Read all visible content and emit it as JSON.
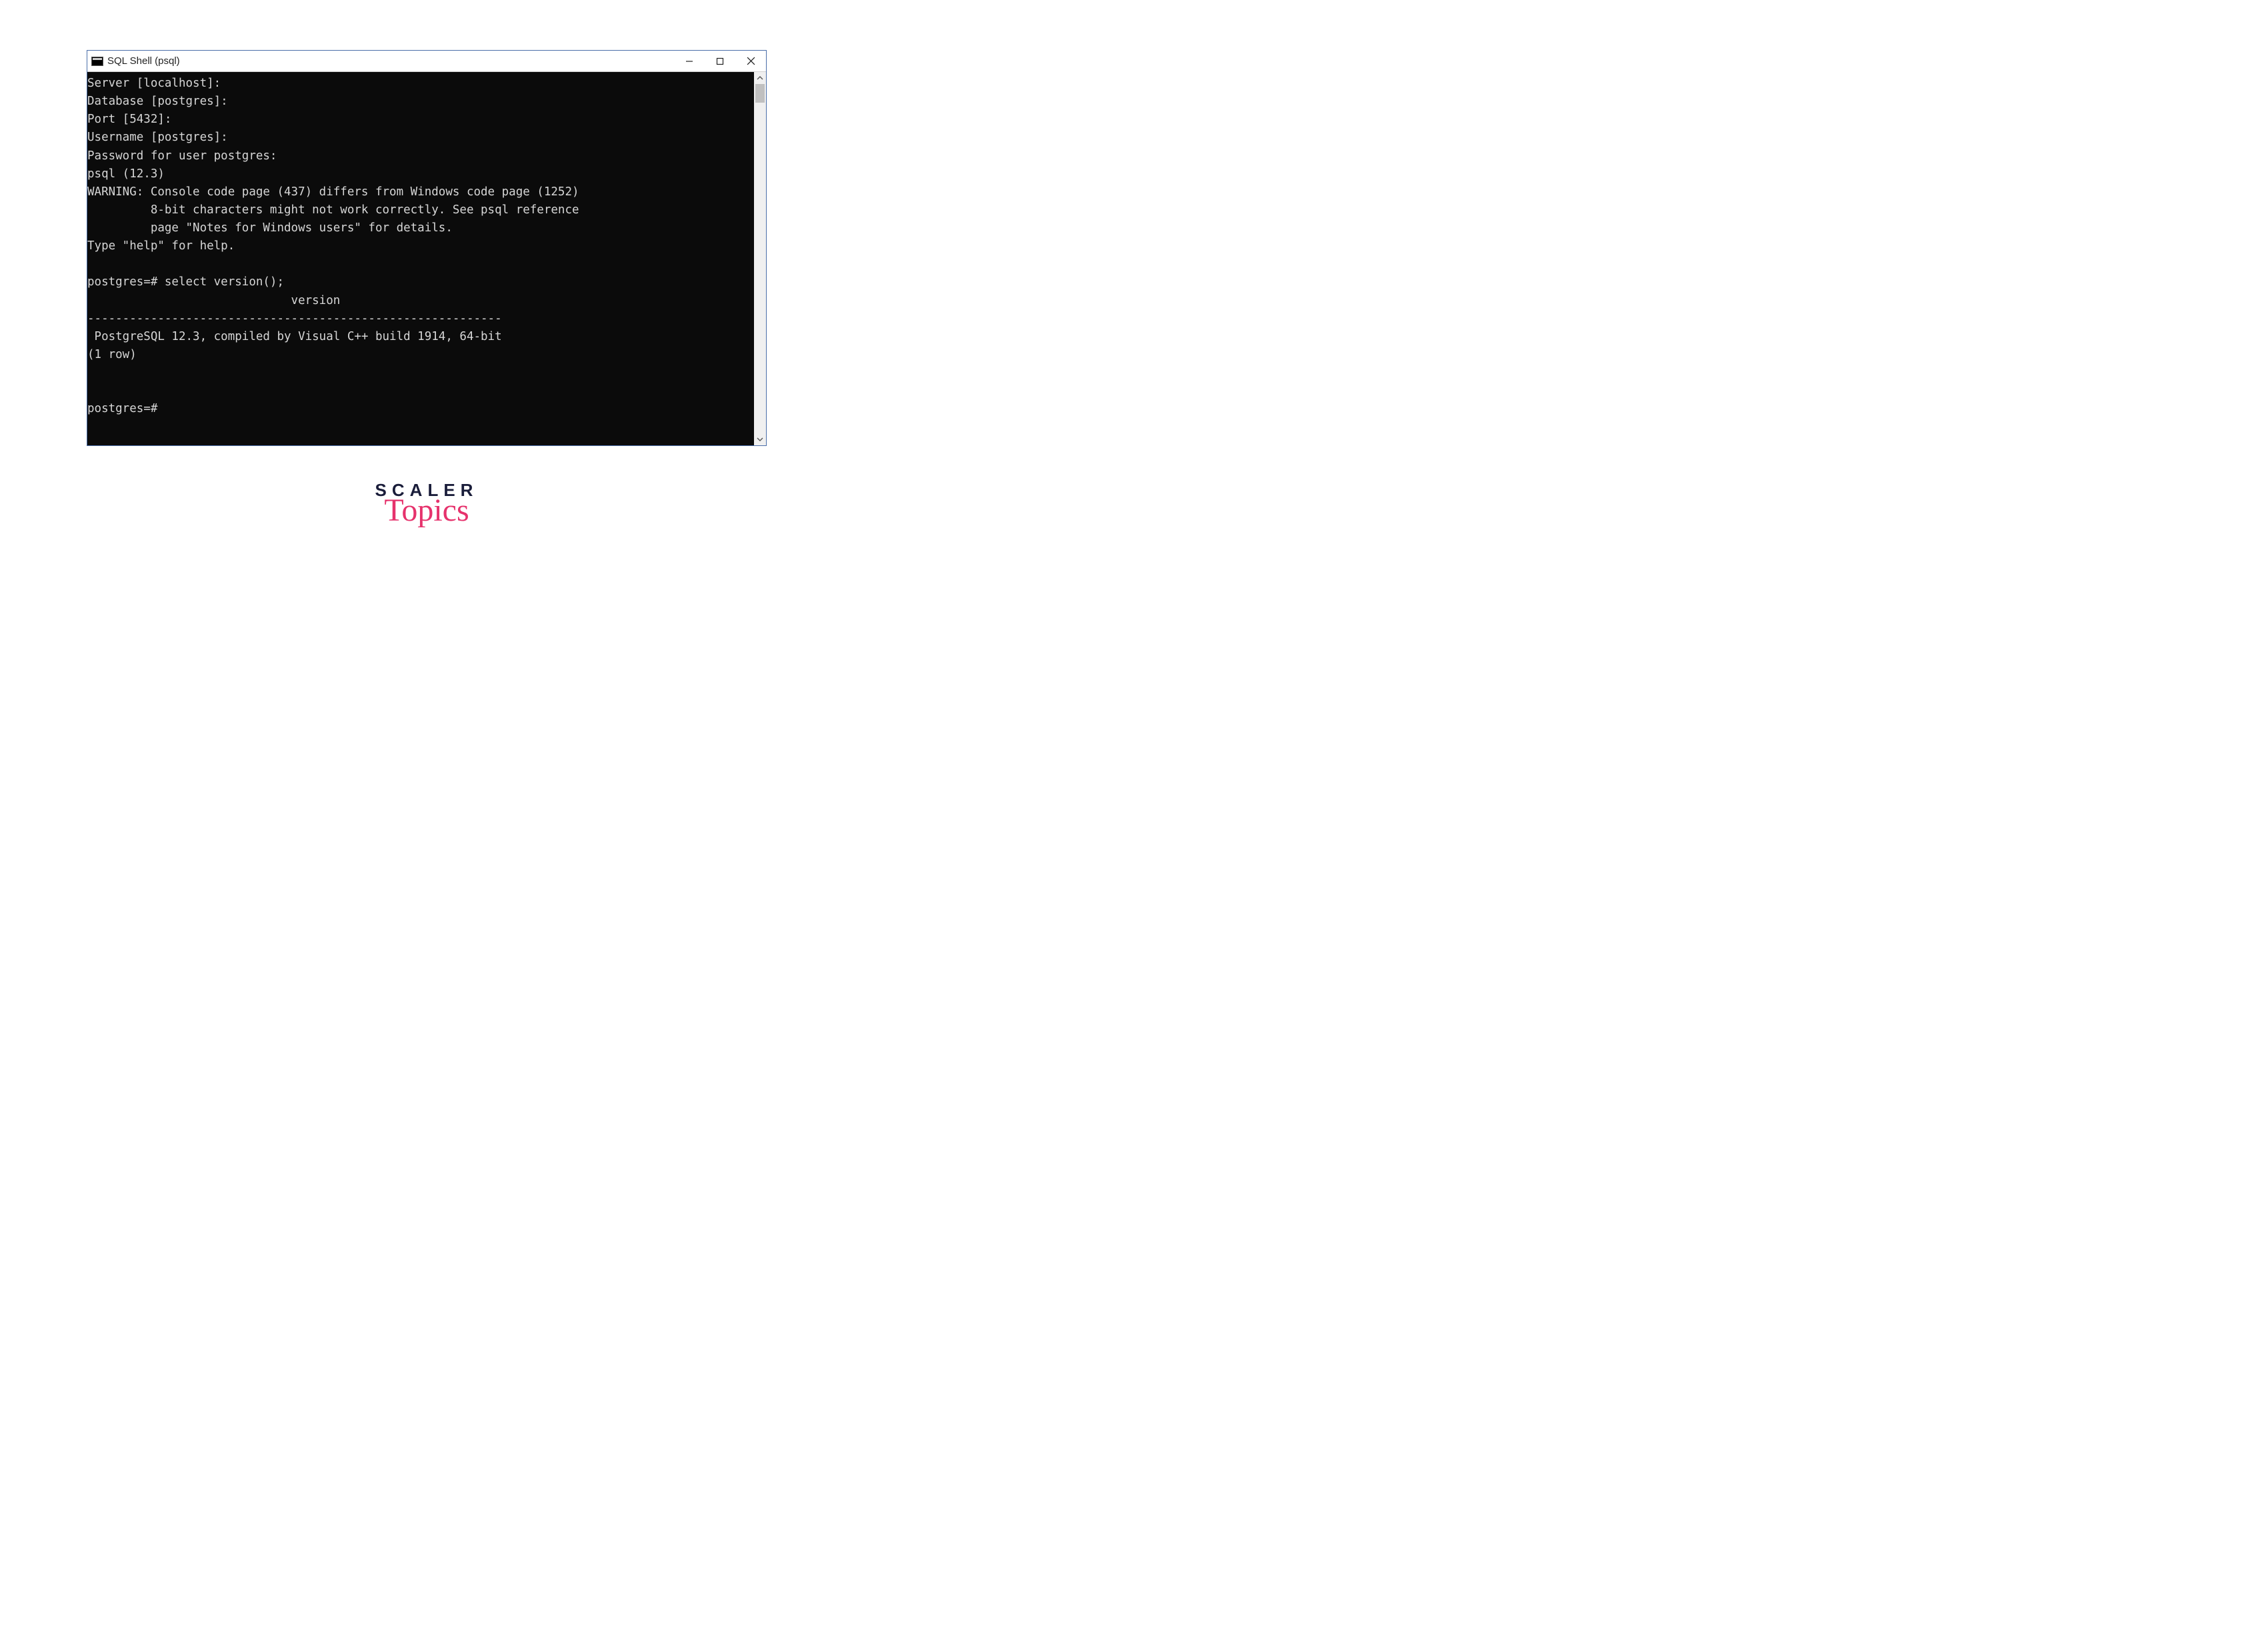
{
  "window": {
    "title": "SQL Shell (psql)"
  },
  "console": {
    "lines": [
      "Server [localhost]:",
      "Database [postgres]:",
      "Port [5432]:",
      "Username [postgres]:",
      "Password for user postgres:",
      "psql (12.3)",
      "WARNING: Console code page (437) differs from Windows code page (1252)",
      "         8-bit characters might not work correctly. See psql reference",
      "         page \"Notes for Windows users\" for details.",
      "Type \"help\" for help.",
      "",
      "postgres=# select version();",
      "                             version",
      "-----------------------------------------------------------",
      " PostgreSQL 12.3, compiled by Visual C++ build 1914, 64-bit",
      "(1 row)",
      "",
      "",
      "postgres=#"
    ]
  },
  "watermark": {
    "line1": "SCALER",
    "line2": "Topics"
  }
}
